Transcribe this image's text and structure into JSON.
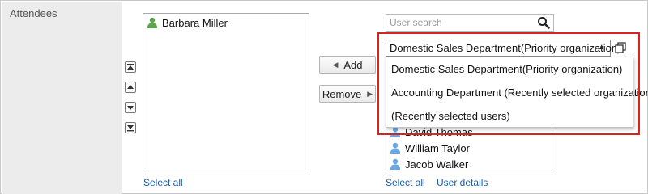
{
  "field_label": "Attendees",
  "selected_list": {
    "items": [
      {
        "name": "Barbara Miller",
        "icon": "user-icon"
      }
    ],
    "select_all": "Select all"
  },
  "order_controls": {
    "top": "move-to-top-icon",
    "up": "move-up-icon",
    "down": "move-down-icon",
    "bottom": "move-to-bottom-icon"
  },
  "buttons": {
    "add": "Add",
    "remove": "Remove"
  },
  "candidates": {
    "search_placeholder": "User search",
    "organization_select": "Domestic Sales Department(Priority organization)",
    "dropdown_options": [
      "Domestic Sales Department(Priority organization)",
      "Accounting Department (Recently selected organization)",
      "(Recently selected users)"
    ],
    "users": [
      {
        "name": "David Thomas",
        "icon": "user-icon"
      },
      {
        "name": "William Taylor",
        "icon": "user-icon"
      },
      {
        "name": "Jacob Walker",
        "icon": "user-icon"
      }
    ],
    "select_all": "Select all",
    "user_details": "User details"
  },
  "colors": {
    "highlight_border": "#d9231e",
    "link": "#1b5fa8",
    "label_bg": "#ececec"
  }
}
